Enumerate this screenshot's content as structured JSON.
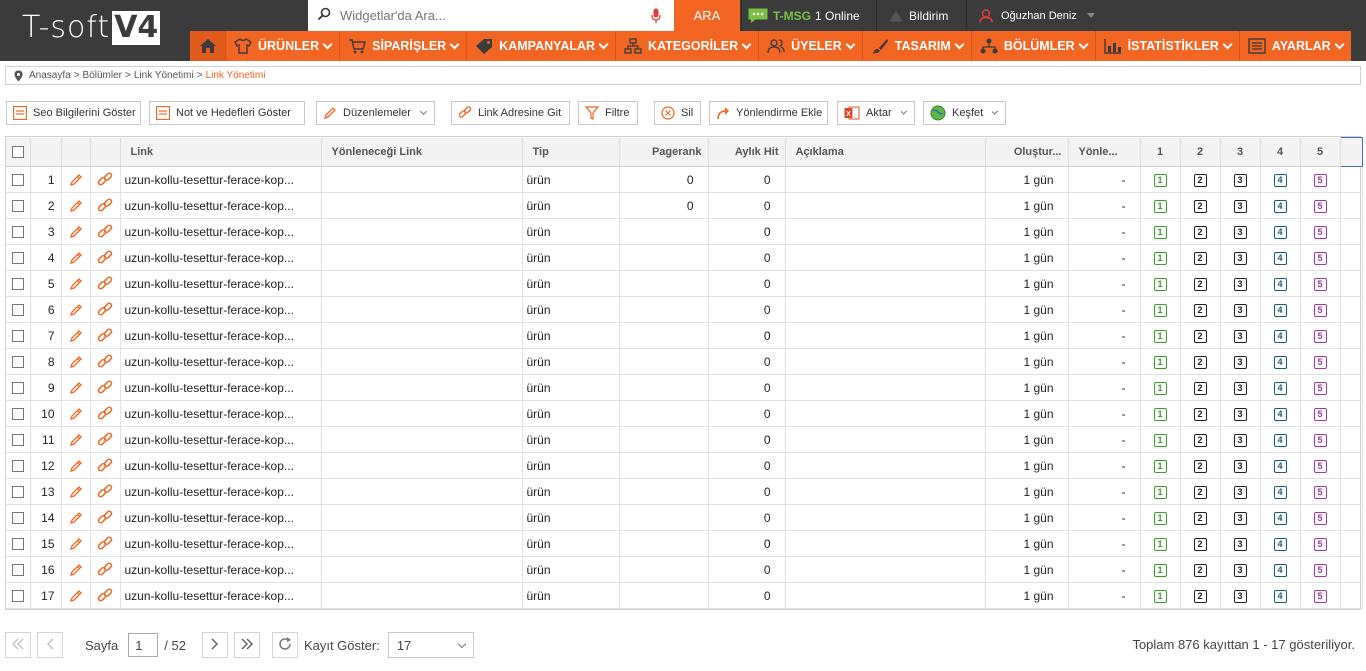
{
  "header": {
    "logo_text": "T-soft",
    "logo_version": "V4",
    "search_placeholder": "Widgetlar'da Ara...",
    "search_button": "ARA",
    "tmsg_label": "T-MSG",
    "tmsg_online": "1 Online",
    "notifications_label": "Bildirim",
    "user_name": "Oğuzhan Deniz"
  },
  "nav": [
    {
      "label": "ÜRÜNLER",
      "icon": "shirt-icon"
    },
    {
      "label": "SİPARİŞLER",
      "icon": "cart-icon"
    },
    {
      "label": "KAMPANYALAR",
      "icon": "tag-icon"
    },
    {
      "label": "KATEGORİLER",
      "icon": "sitemap-icon"
    },
    {
      "label": "ÜYELER",
      "icon": "users-icon"
    },
    {
      "label": "TASARIM",
      "icon": "brush-icon"
    },
    {
      "label": "BÖLÜMLER",
      "icon": "network-icon"
    },
    {
      "label": "İSTATİSTİKLER",
      "icon": "chart-icon"
    },
    {
      "label": "AYARLAR",
      "icon": "settings-list-icon"
    }
  ],
  "breadcrumb": {
    "items": [
      "Anasayfa",
      "Bölümler",
      "Link Yönetimi"
    ],
    "current": "Link Yönetimi",
    "separator": ">"
  },
  "toolbar": {
    "seo": "Seo Bilgilerini Göster",
    "notes": "Not ve Hedefleri Göster",
    "edit": "Düzenlemeler",
    "goto": "Link Adresine Git",
    "filter": "Filtre",
    "delete": "Sil",
    "redirect": "Yönlendirme Ekle",
    "export": "Aktar",
    "discover": "Keşfet"
  },
  "table": {
    "headers": {
      "link": "Link",
      "redirect_link": "Yönleneceği Link",
      "type": "Tip",
      "pagerank": "Pagerank",
      "monthly_hit": "Aylık Hit",
      "description": "Açıklama",
      "created": "Oluştur...",
      "direction": "Yönle...",
      "c1": "1",
      "c2": "2",
      "c3": "3",
      "c4": "4",
      "c5": "5"
    },
    "rows": [
      {
        "no": "1",
        "link": "uzun-kollu-tesettur-ferace-kop...",
        "redirect": "",
        "type": "ürün",
        "pagerank": "0",
        "hit": "0",
        "desc": "",
        "created": "1 gün",
        "dir": "-"
      },
      {
        "no": "2",
        "link": "uzun-kollu-tesettur-ferace-kop...",
        "redirect": "",
        "type": "ürün",
        "pagerank": "0",
        "hit": "0",
        "desc": "",
        "created": "1 gün",
        "dir": "-"
      },
      {
        "no": "3",
        "link": "uzun-kollu-tesettur-ferace-kop...",
        "redirect": "",
        "type": "ürün",
        "pagerank": "",
        "hit": "0",
        "desc": "",
        "created": "1 gün",
        "dir": "-"
      },
      {
        "no": "4",
        "link": "uzun-kollu-tesettur-ferace-kop...",
        "redirect": "",
        "type": "ürün",
        "pagerank": "",
        "hit": "0",
        "desc": "",
        "created": "1 gün",
        "dir": "-"
      },
      {
        "no": "5",
        "link": "uzun-kollu-tesettur-ferace-kop...",
        "redirect": "",
        "type": "ürün",
        "pagerank": "",
        "hit": "0",
        "desc": "",
        "created": "1 gün",
        "dir": "-"
      },
      {
        "no": "6",
        "link": "uzun-kollu-tesettur-ferace-kop...",
        "redirect": "",
        "type": "ürün",
        "pagerank": "",
        "hit": "0",
        "desc": "",
        "created": "1 gün",
        "dir": "-"
      },
      {
        "no": "7",
        "link": "uzun-kollu-tesettur-ferace-kop...",
        "redirect": "",
        "type": "ürün",
        "pagerank": "",
        "hit": "0",
        "desc": "",
        "created": "1 gün",
        "dir": "-"
      },
      {
        "no": "8",
        "link": "uzun-kollu-tesettur-ferace-kop...",
        "redirect": "",
        "type": "ürün",
        "pagerank": "",
        "hit": "0",
        "desc": "",
        "created": "1 gün",
        "dir": "-"
      },
      {
        "no": "9",
        "link": "uzun-kollu-tesettur-ferace-kop...",
        "redirect": "",
        "type": "ürün",
        "pagerank": "",
        "hit": "0",
        "desc": "",
        "created": "1 gün",
        "dir": "-"
      },
      {
        "no": "10",
        "link": "uzun-kollu-tesettur-ferace-kop...",
        "redirect": "",
        "type": "ürün",
        "pagerank": "",
        "hit": "0",
        "desc": "",
        "created": "1 gün",
        "dir": "-"
      },
      {
        "no": "11",
        "link": "uzun-kollu-tesettur-ferace-kop...",
        "redirect": "",
        "type": "ürün",
        "pagerank": "",
        "hit": "0",
        "desc": "",
        "created": "1 gün",
        "dir": "-"
      },
      {
        "no": "12",
        "link": "uzun-kollu-tesettur-ferace-kop...",
        "redirect": "",
        "type": "ürün",
        "pagerank": "",
        "hit": "0",
        "desc": "",
        "created": "1 gün",
        "dir": "-"
      },
      {
        "no": "13",
        "link": "uzun-kollu-tesettur-ferace-kop...",
        "redirect": "",
        "type": "ürün",
        "pagerank": "",
        "hit": "0",
        "desc": "",
        "created": "1 gün",
        "dir": "-"
      },
      {
        "no": "14",
        "link": "uzun-kollu-tesettur-ferace-kop...",
        "redirect": "",
        "type": "ürün",
        "pagerank": "",
        "hit": "0",
        "desc": "",
        "created": "1 gün",
        "dir": "-"
      },
      {
        "no": "15",
        "link": "uzun-kollu-tesettur-ferace-kop...",
        "redirect": "",
        "type": "ürün",
        "pagerank": "",
        "hit": "0",
        "desc": "",
        "created": "1 gün",
        "dir": "-"
      },
      {
        "no": "16",
        "link": "uzun-kollu-tesettur-ferace-kop...",
        "redirect": "",
        "type": "ürün",
        "pagerank": "",
        "hit": "0",
        "desc": "",
        "created": "1 gün",
        "dir": "-"
      },
      {
        "no": "17",
        "link": "uzun-kollu-tesettur-ferace-kop...",
        "redirect": "",
        "type": "ürün",
        "pagerank": "",
        "hit": "0",
        "desc": "",
        "created": "1 gün",
        "dir": "-"
      }
    ],
    "flags": [
      "1",
      "2",
      "3",
      "4",
      "5"
    ]
  },
  "pager": {
    "page_label": "Sayfa",
    "current_page": "1",
    "total_pages": "/ 52",
    "records_label": "Kayıt Göster:",
    "records_value": "17",
    "summary": "Toplam 876 kayıttan 1 - 17 gösteriliyor."
  },
  "colors": {
    "accent": "#f26522",
    "header_bg": "#3b3b3b",
    "flag1": "#3a9a2a",
    "flag4": "#1a5c6e",
    "flag5": "#9b3a9b"
  }
}
